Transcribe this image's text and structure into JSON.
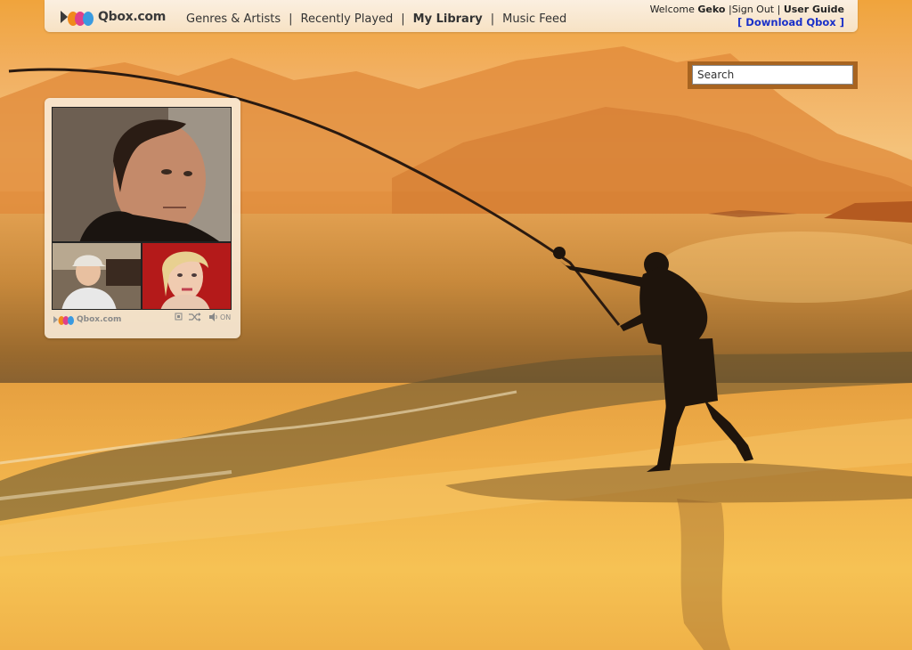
{
  "site": {
    "logo_text": "Qbox.com"
  },
  "nav": {
    "items": [
      {
        "label": "Genres & Artists",
        "active": false
      },
      {
        "label": "Recently Played",
        "active": false
      },
      {
        "label": "My Library",
        "active": true
      },
      {
        "label": "Music Feed",
        "active": false
      }
    ],
    "separator": "|"
  },
  "user": {
    "welcome_prefix": "Welcome",
    "username": "Geko",
    "sign_out": "Sign Out",
    "user_guide": "User Guide",
    "download": "[ Download Qbox ]"
  },
  "search": {
    "placeholder": "Search"
  },
  "widget": {
    "logo_text": "Qbox.com",
    "volume_label": "ON",
    "icons": [
      "repeat-icon",
      "shuffle-icon",
      "speaker-icon"
    ]
  },
  "colors": {
    "accent_link": "#1a30c8",
    "search_border": "#a86420",
    "logo_orange": "#f08a1c",
    "logo_pink": "#e0408a",
    "logo_blue": "#3a9ae0"
  }
}
